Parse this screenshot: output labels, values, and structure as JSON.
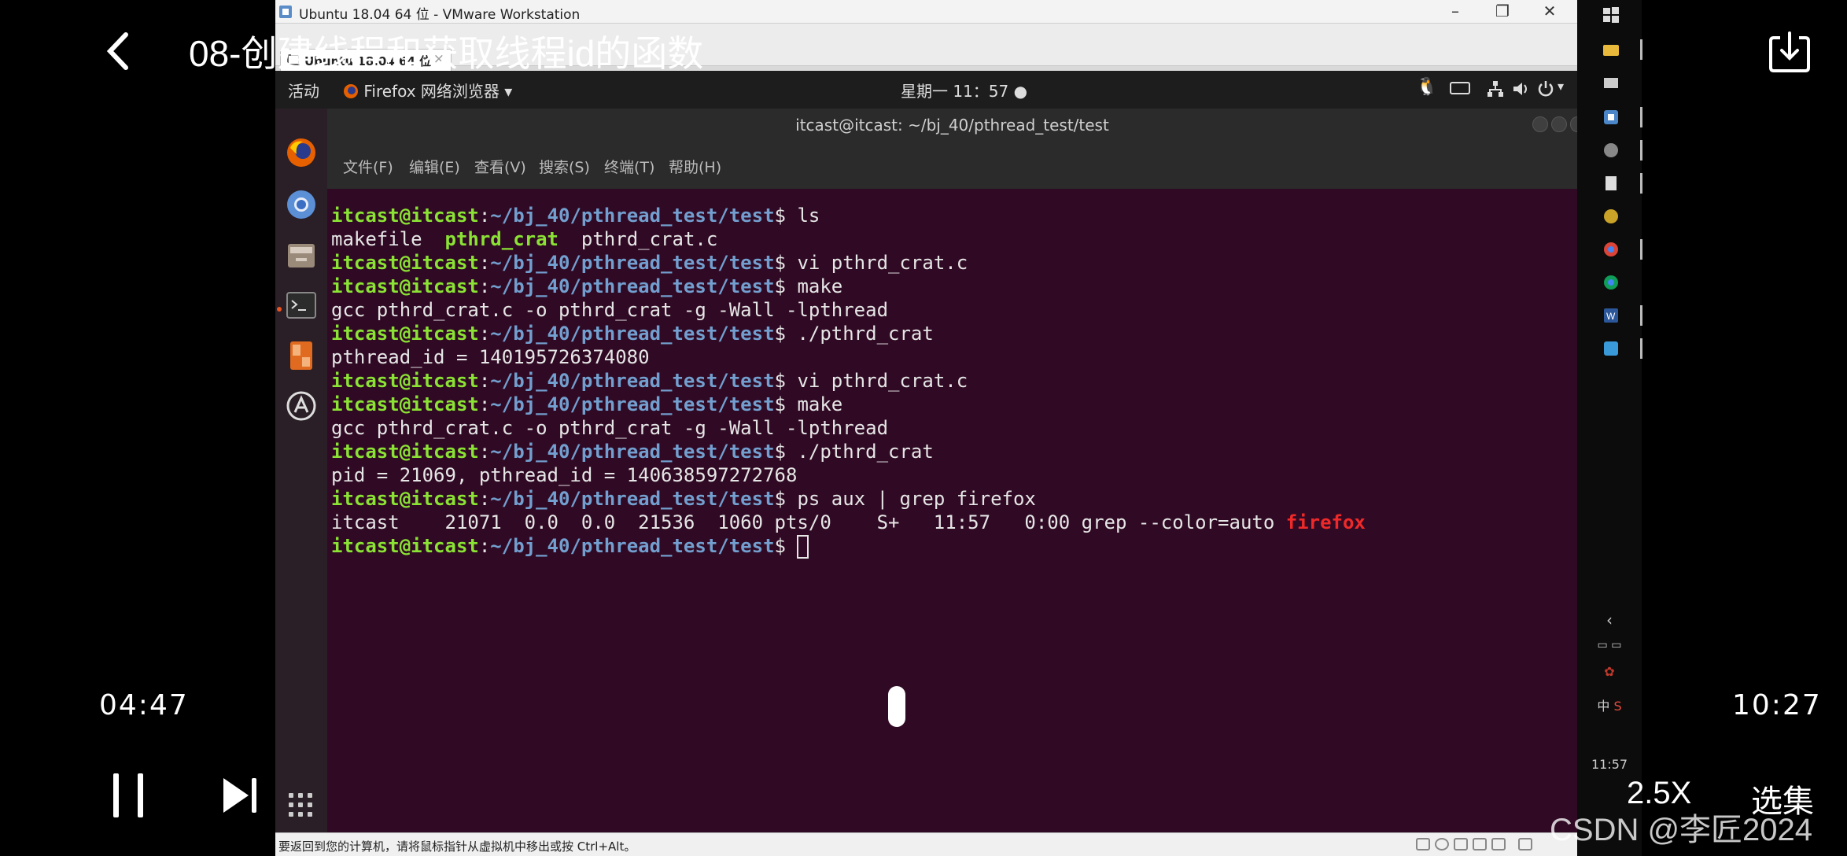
{
  "player": {
    "title": "08-创建线程和获取线程id的函数",
    "time_current": "04:47",
    "time_total": "10:27",
    "speed": "2.5X",
    "episodes": "选集",
    "watermark": "CSDN @李匠2024"
  },
  "vmware": {
    "window_title": "Ubuntu 18.04 64 位 - VMware Workstation",
    "tab_label": "Ubuntu 18.04 64 位",
    "tab_close": "×",
    "status_message": "要返回到您的计算机，请将鼠标指针从虚拟机中移出或按 Ctrl+Alt。",
    "min": "–",
    "restore": "❐",
    "close": "✕"
  },
  "ubuntu_bar": {
    "activities": "活动",
    "app_menu": "Firefox 网络浏览器 ▾",
    "clock": "星期一 11：57 ●"
  },
  "terminal": {
    "title": "itcast@itcast: ~/bj_40/pthread_test/test",
    "menu": [
      "文件(F)",
      "编辑(E)",
      "查看(V)",
      "搜索(S)",
      "终端(T)",
      "帮助(H)"
    ],
    "prompt_user": "itcast@itcast",
    "prompt_path": "~/bj_40/pthread_test/test",
    "prompt_sep": ":",
    "prompt_end": "$ ",
    "lines": [
      {
        "type": "cmd",
        "text": "ls"
      },
      {
        "type": "ls",
        "parts": [
          "makefile  ",
          "pthrd_crat",
          "  pthrd_crat.c"
        ]
      },
      {
        "type": "cmd",
        "text": "vi pthrd_crat.c"
      },
      {
        "type": "cmd",
        "text": "make"
      },
      {
        "type": "out",
        "text": "gcc pthrd_crat.c -o pthrd_crat -g -Wall -lpthread"
      },
      {
        "type": "cmd",
        "text": "./pthrd_crat"
      },
      {
        "type": "out",
        "text": "pthread_id = 140195726374080"
      },
      {
        "type": "cmd",
        "text": "vi pthrd_crat.c"
      },
      {
        "type": "cmd",
        "text": "make"
      },
      {
        "type": "out",
        "text": "gcc pthrd_crat.c -o pthrd_crat -g -Wall -lpthread"
      },
      {
        "type": "cmd",
        "text": "./pthrd_crat"
      },
      {
        "type": "out",
        "text": "pid = 21069, pthread_id = 140638597272768"
      },
      {
        "type": "cmd",
        "text": "ps aux | grep firefox"
      },
      {
        "type": "grep",
        "parts": [
          "itcast    21071  0.0  0.0  21536  1060 pts/0    S+   11:57   0:00 grep --color=auto ",
          "firefox"
        ]
      },
      {
        "type": "prompt"
      }
    ]
  },
  "windows_taskbar": {
    "time": "11:57",
    "ime": "中"
  },
  "icons": {
    "back": "chevron-left-icon",
    "download": "download-icon",
    "pause": "pause-icon",
    "next": "skip-next-icon"
  },
  "colors": {
    "terminal_bg": "#300a24",
    "prompt_user": "#8ae234",
    "prompt_path": "#729fcf",
    "grep_match": "#ef2929"
  }
}
